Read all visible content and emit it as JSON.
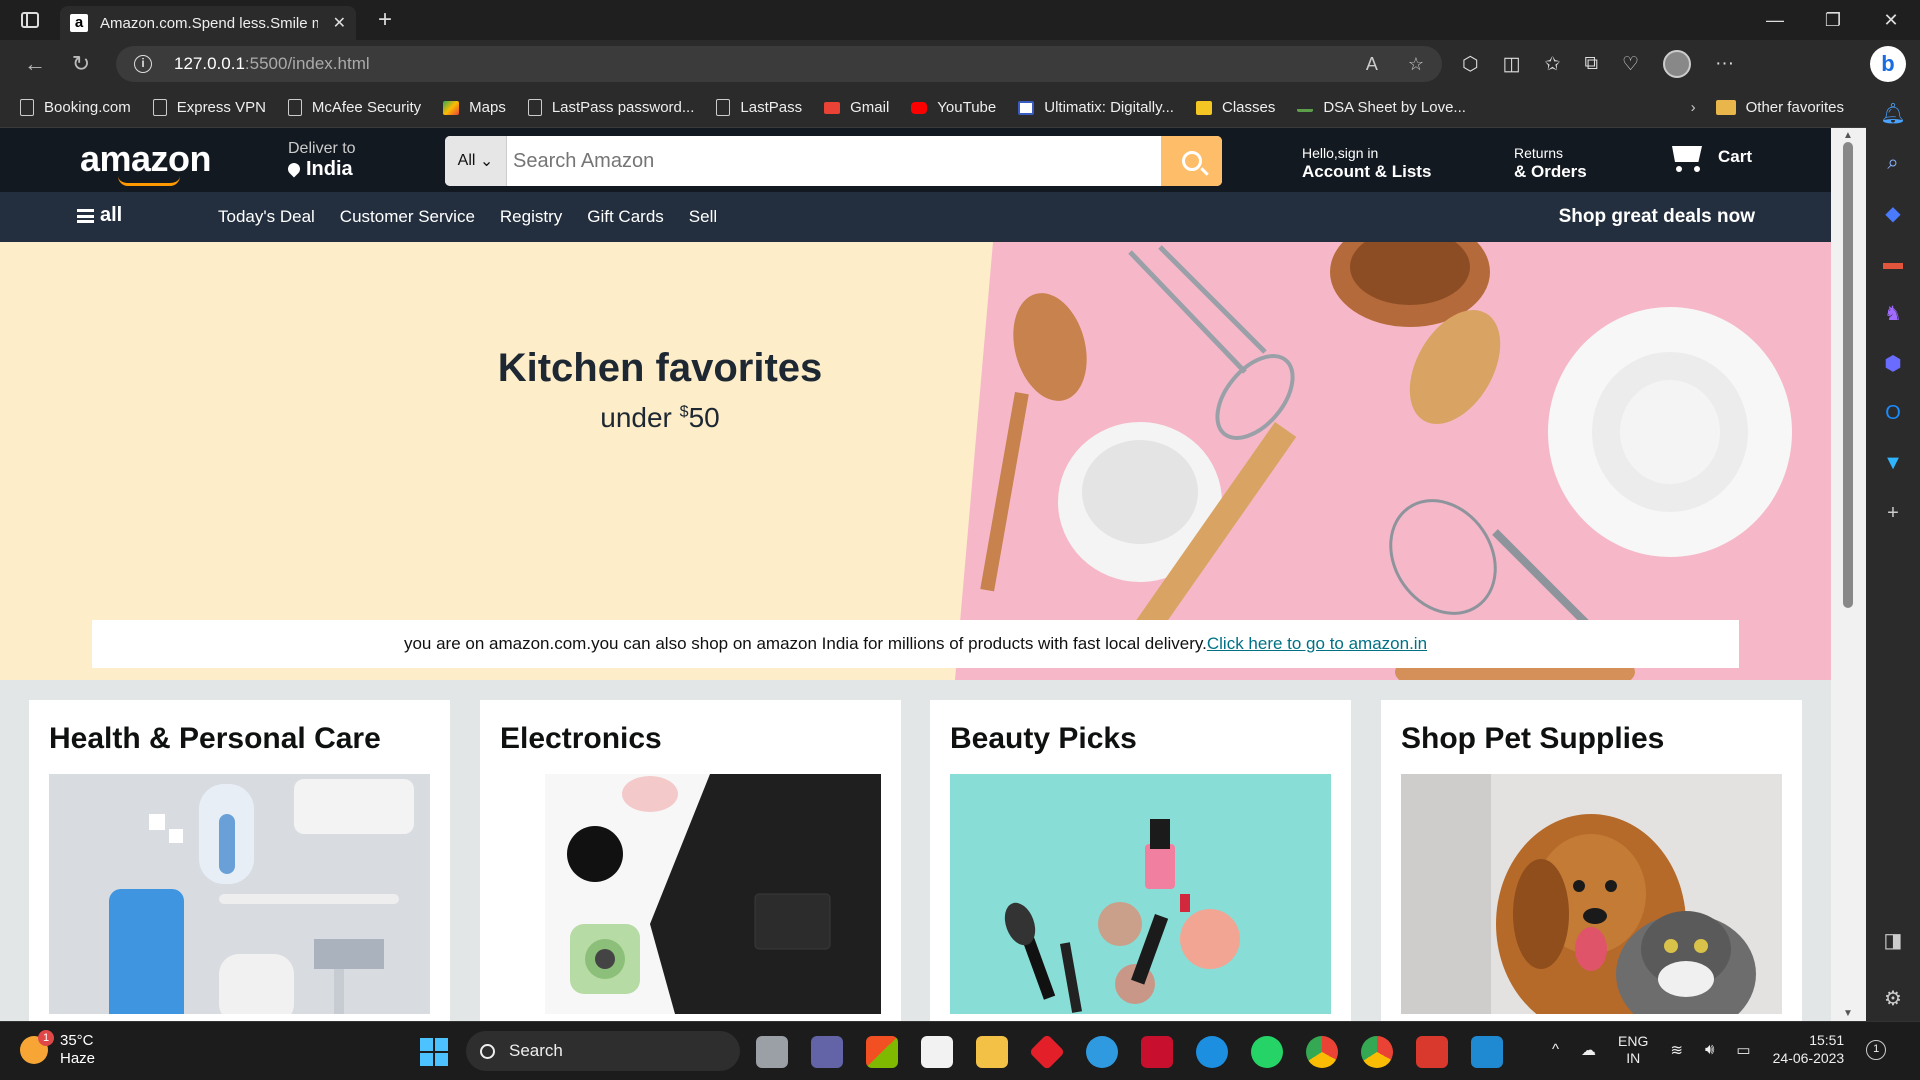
{
  "browser": {
    "tab_title": "Amazon.com.Spend less.Smile more",
    "url_host": "127.0.0.1",
    "url_path": ":5500/index.html",
    "bookmarks": [
      {
        "label": "Booking.com",
        "icon": "page-icon"
      },
      {
        "label": "Express VPN",
        "icon": "page-icon"
      },
      {
        "label": "McAfee Security",
        "icon": "page-icon"
      },
      {
        "label": "Maps",
        "icon": "maps-icon"
      },
      {
        "label": "LastPass password...",
        "icon": "page-icon"
      },
      {
        "label": "LastPass",
        "icon": "page-icon"
      },
      {
        "label": "Gmail",
        "icon": "gmail-icon"
      },
      {
        "label": "YouTube",
        "icon": "youtube-icon"
      },
      {
        "label": "Ultimatix: Digitally...",
        "icon": "tcs-icon"
      },
      {
        "label": "Classes",
        "icon": "classroom-icon"
      },
      {
        "label": "DSA Sheet by Love...",
        "icon": "link-icon"
      }
    ],
    "other_favorites": "Other favorites"
  },
  "amazon": {
    "logo": "amazon",
    "deliver_line1": "Deliver to",
    "deliver_line2": "India",
    "search_category": "All",
    "search_placeholder": "Search Amazon",
    "account_line1": "Hello,sign in",
    "account_line2": "Account & Lists",
    "orders_line1": "Returns",
    "orders_line2": "& Orders",
    "cart": "Cart",
    "all_label": "all",
    "nav_links": [
      "Today's Deal",
      "Customer Service",
      "Registry",
      "Gift Cards",
      "Sell"
    ],
    "deals": "Shop great deals now",
    "hero_title": "Kitchen favorites",
    "hero_sub_prefix": "under ",
    "hero_currency": "$",
    "hero_amount": "50",
    "notice_text": "you are on amazon.com.you can also shop on amazon India for millions of products with fast local delivery.",
    "notice_link": "Click here to go to amazon.in",
    "cards": [
      {
        "title": "Health & Personal Care"
      },
      {
        "title": "Electronics"
      },
      {
        "title": "Beauty Picks"
      },
      {
        "title": "Shop Pet Supplies"
      }
    ]
  },
  "taskbar": {
    "temp": "35°C",
    "condition": "Haze",
    "weather_badge": "1",
    "search_label": "Search",
    "lang1": "ENG",
    "lang2": "IN",
    "time": "15:51",
    "date": "24-06-2023",
    "notif_count": "1"
  },
  "colors": {
    "amazon_dark": "#131921",
    "amazon_nav": "#232f3e",
    "search_button": "#febd69",
    "hero_bg": "#fdedc9",
    "hero_pink": "#f6b8c8",
    "link": "#007185"
  }
}
